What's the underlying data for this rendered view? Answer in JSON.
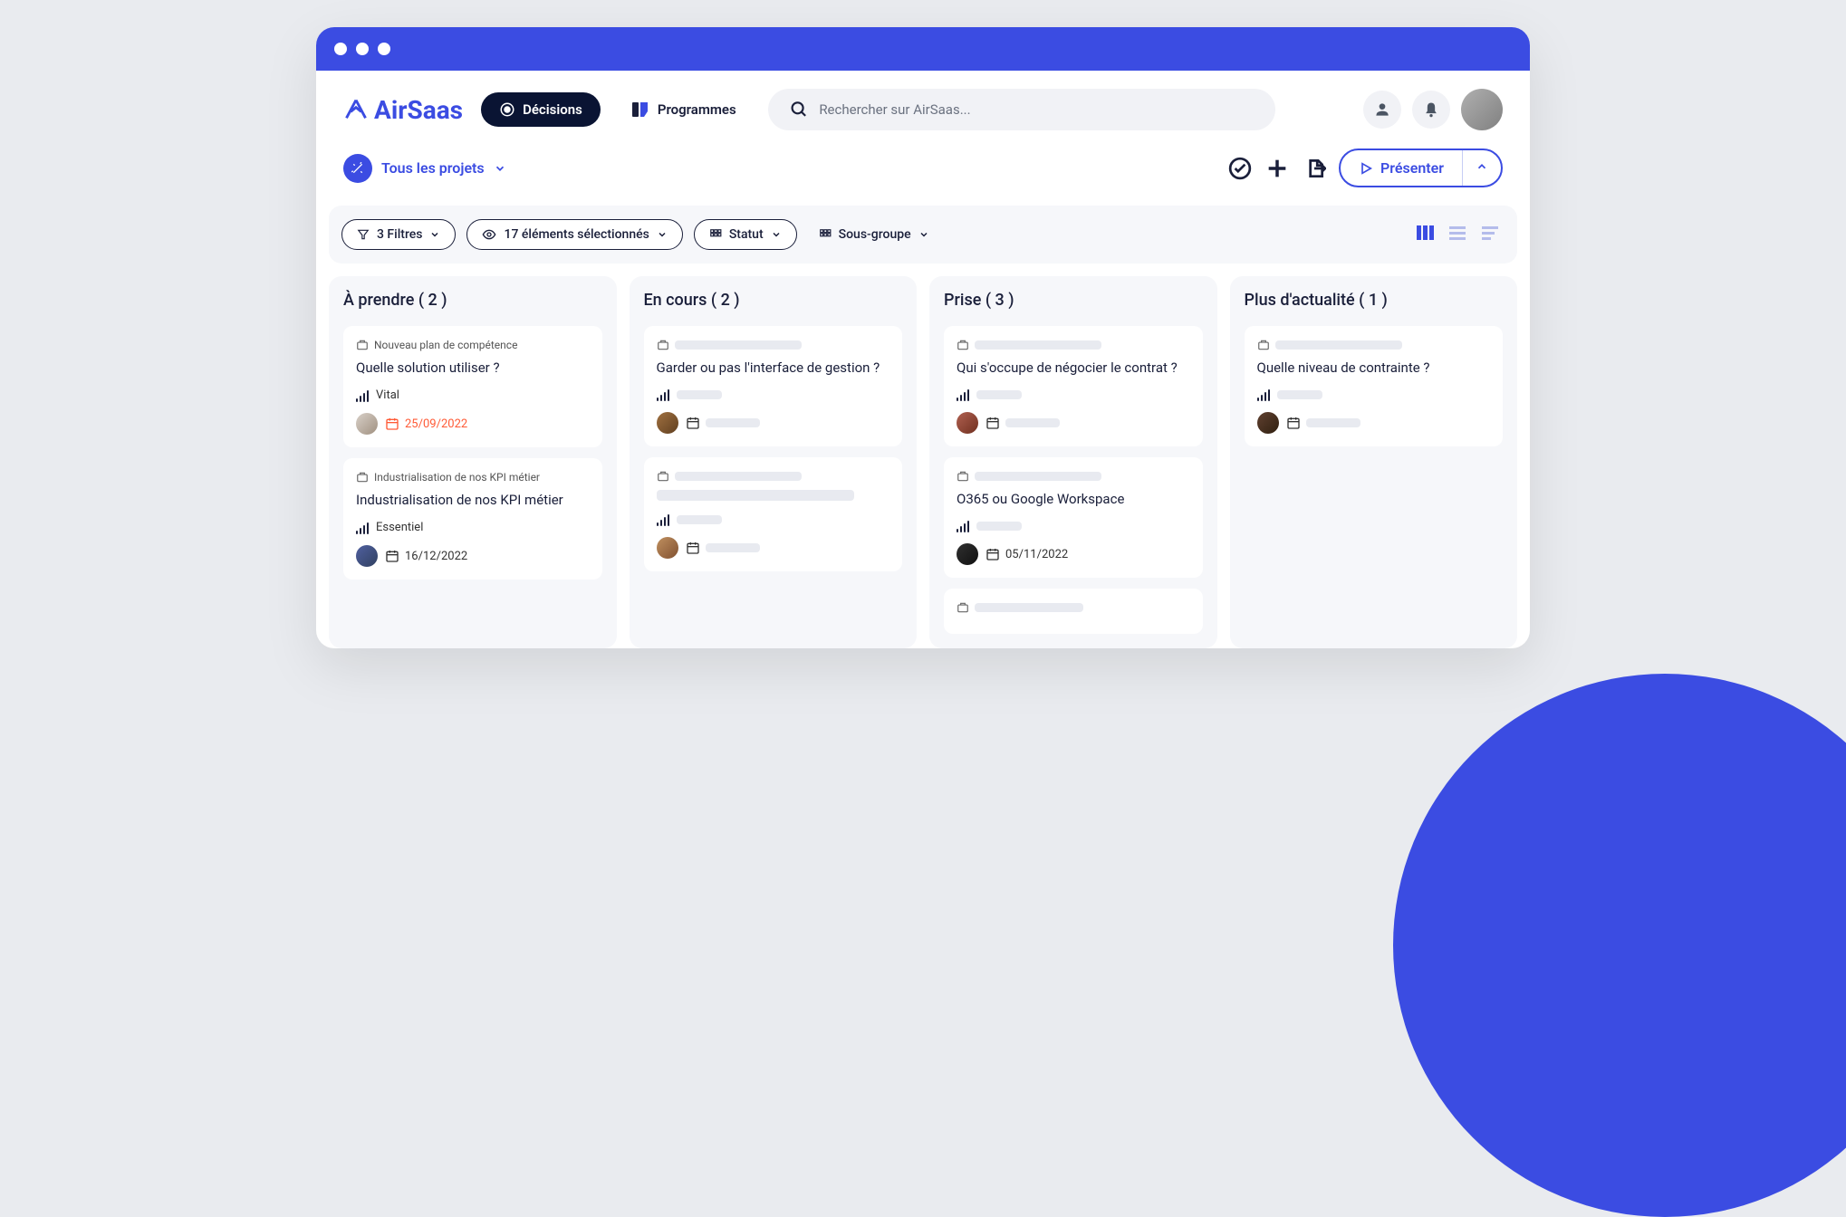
{
  "brand": "AirSaas",
  "nav": {
    "decisions": "Décisions",
    "programmes": "Programmes"
  },
  "search": {
    "placeholder": "Rechercher sur AirSaas..."
  },
  "projectSelector": {
    "label": "Tous les projets"
  },
  "actions": {
    "present": "Présenter"
  },
  "filters": {
    "count": "3 Filtres",
    "selection": "17 éléments sélectionnés",
    "status": "Statut",
    "subgroup": "Sous-groupe"
  },
  "columns": [
    {
      "title": "À prendre ( 2 )",
      "cards": [
        {
          "tag": "Nouveau plan de compétence",
          "title": "Quelle solution utiliser ?",
          "priority": "Vital",
          "date": "25/09/2022",
          "overdue": true,
          "avatarColor": "linear-gradient(135deg,#d8d0c8,#a09080)"
        },
        {
          "tag": "Industrialisation de nos KPI métier",
          "title": "Industrialisation de nos KPI métier",
          "priority": "Essentiel",
          "date": "16/12/2022",
          "overdue": false,
          "avatarColor": "linear-gradient(135deg,#5060a0,#304060)"
        }
      ]
    },
    {
      "title": "En cours ( 2 )",
      "cards": [
        {
          "tag": "",
          "title": "Garder ou pas l'interface de gestion ?",
          "priority": "",
          "date": "",
          "overdue": false,
          "avatarColor": "linear-gradient(135deg,#a07040,#604020)"
        },
        {
          "tag": "",
          "title": "",
          "priority": "",
          "date": "",
          "overdue": false,
          "avatarColor": "linear-gradient(135deg,#c09060,#805030)"
        }
      ]
    },
    {
      "title": "Prise ( 3 )",
      "cards": [
        {
          "tag": "",
          "title": "Qui s'occupe de négocier le contrat ?",
          "priority": "",
          "date": "",
          "overdue": false,
          "avatarColor": "linear-gradient(135deg,#b06050,#703020)"
        },
        {
          "tag": "",
          "title": "O365 ou Google Workspace",
          "priority": "",
          "date": "05/11/2022",
          "overdue": false,
          "avatarColor": "linear-gradient(135deg,#303030,#101010)"
        }
      ]
    },
    {
      "title": "Plus d'actualité ( 1 )",
      "cards": [
        {
          "tag": "",
          "title": "Quelle niveau de contrainte ?",
          "priority": "",
          "date": "",
          "overdue": false,
          "avatarColor": "linear-gradient(135deg,#604030,#302010)"
        }
      ]
    }
  ]
}
